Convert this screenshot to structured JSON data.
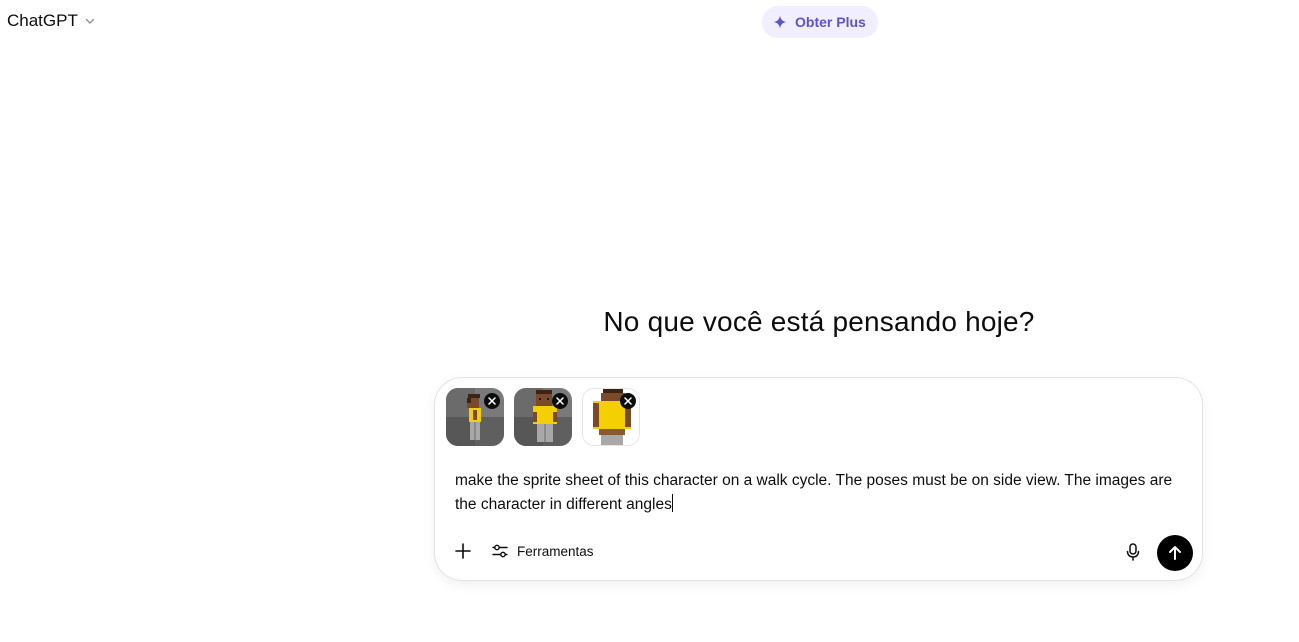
{
  "header": {
    "model_label": "ChatGPT",
    "model_icon": "chevron-down-icon",
    "upgrade_label": "Obter Plus",
    "upgrade_icon": "sparkle-icon"
  },
  "main": {
    "greeting": "No que você está pensando hoje?"
  },
  "composer": {
    "attachments": [
      {
        "kind": "image",
        "remove_icon": "close-icon"
      },
      {
        "kind": "image",
        "remove_icon": "close-icon"
      },
      {
        "kind": "image",
        "remove_icon": "close-icon"
      }
    ],
    "input_value": "make the sprite sheet of this character on a walk cycle. The poses must be on side view. The images are the character in different angles",
    "add_icon": "plus-icon",
    "tools_label": "Ferramentas",
    "tools_icon": "sliders-icon",
    "mic_icon": "microphone-icon",
    "send_icon": "arrow-up-icon"
  },
  "colors": {
    "accent": "#5b54c8",
    "upgrade_bg": "#f1efff",
    "send_bg": "#000000",
    "character_shirt": "#f5d000",
    "character_skin": "#7a4a2a"
  }
}
